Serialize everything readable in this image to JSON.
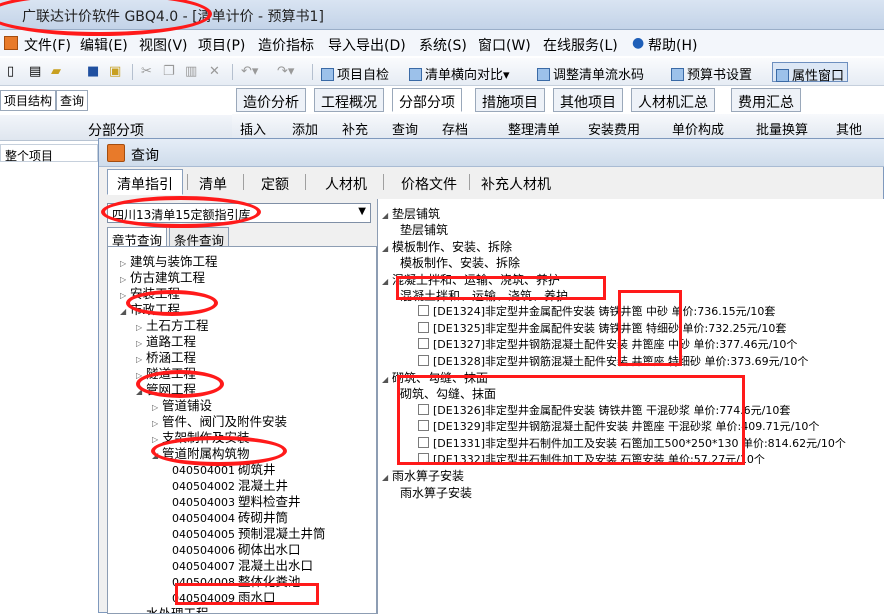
{
  "app": {
    "title": "广联达计价软件 GBQ4.0 - [清单计价 - 预算书1]"
  },
  "menu": [
    "文件(F)",
    "编辑(E)",
    "视图(V)",
    "项目(P)",
    "造价指标",
    "导入导出(D)",
    "系统(S)",
    "窗口(W)",
    "在线服务(L)",
    "帮助(H)"
  ],
  "toolbar": {
    "project_check": "项目自检",
    "compare": "清单横向对比",
    "adjust_flow": "调整清单流水码",
    "budget_settings": "预算书设置",
    "property_window": "属性窗口"
  },
  "left_panel": {
    "tabs": [
      "项目结构",
      "查询"
    ],
    "header": "分部分项",
    "root_item": "整个项目"
  },
  "main_tabs": [
    "造价分析",
    "工程概况",
    "分部分项",
    "措施项目",
    "其他项目",
    "人材机汇总",
    "费用汇总"
  ],
  "sub_toolbar": [
    "插入",
    "添加",
    "补充",
    "查询",
    "存档",
    "整理清单",
    "安装费用",
    "单价构成",
    "批量换算",
    "其他"
  ],
  "dialog": {
    "title": "查询",
    "tabs": [
      "清单指引",
      "清单",
      "定额",
      "人材机",
      "价格文件",
      "补充人材机"
    ],
    "library": "四川13清单15定额指引库",
    "search_tabs": [
      "章节查询",
      "条件查询"
    ],
    "tree": [
      {
        "label": "建筑与装饰工程",
        "level": 0,
        "expanded": false
      },
      {
        "label": "仿古建筑工程",
        "level": 0,
        "expanded": false
      },
      {
        "label": "安装工程",
        "level": 0,
        "expanded": false
      },
      {
        "label": "市政工程",
        "level": 0,
        "expanded": true
      },
      {
        "label": "土石方工程",
        "level": 1,
        "expanded": false
      },
      {
        "label": "道路工程",
        "level": 1,
        "expanded": false
      },
      {
        "label": "桥涵工程",
        "level": 1,
        "expanded": false
      },
      {
        "label": "隧道工程",
        "level": 1,
        "expanded": false
      },
      {
        "label": "管网工程",
        "level": 1,
        "expanded": true
      },
      {
        "label": "管道铺设",
        "level": 2,
        "expanded": false
      },
      {
        "label": "管件、阀门及附件安装",
        "level": 2,
        "expanded": false
      },
      {
        "label": "支架制作及安装",
        "level": 2,
        "expanded": false
      },
      {
        "label": "管道附属构筑物",
        "level": 2,
        "expanded": true
      },
      {
        "code": "040504001",
        "label": "砌筑井",
        "level": 3
      },
      {
        "code": "040504002",
        "label": "混凝土井",
        "level": 3
      },
      {
        "code": "040504003",
        "label": "塑料检查井",
        "level": 3
      },
      {
        "code": "040504004",
        "label": "砖砌井筒",
        "level": 3
      },
      {
        "code": "040504005",
        "label": "预制混凝土井筒",
        "level": 3
      },
      {
        "code": "040504006",
        "label": "砌体出水口",
        "level": 3
      },
      {
        "code": "040504007",
        "label": "混凝土出水口",
        "level": 3
      },
      {
        "code": "040504008",
        "label": "整体化粪池",
        "level": 3
      },
      {
        "code": "040504009",
        "label": "雨水口",
        "level": 3
      },
      {
        "label": "水处理工程",
        "level": 1,
        "expanded": false
      }
    ],
    "right_tree": [
      {
        "label": "垫层铺筑",
        "level": 0
      },
      {
        "label": "垫层铺筑",
        "level": 1
      },
      {
        "label": "模板制作、安装、拆除",
        "level": 0
      },
      {
        "label": "模板制作、安装、拆除",
        "level": 1
      },
      {
        "label": "混凝土拌和、运输、浇筑、养护",
        "level": 0
      },
      {
        "label": "混凝土拌和、运输、浇筑、养护",
        "level": 1
      },
      {
        "label": "[DE1324]非定型井金属配件安装 铸铁井篦 中砂 单价:736.15元/10套",
        "level": 2
      },
      {
        "label": "[DE1325]非定型井金属配件安装 铸铁井篦 特细砂 单价:732.25元/10套",
        "level": 2
      },
      {
        "label": "[DE1327]非定型井钢筋混凝土配件安装 井篦座 中砂 单价:377.46元/10个",
        "level": 2
      },
      {
        "label": "[DE1328]非定型井钢筋混凝土配件安装 井篦座 特细砂 单价:373.69元/10个",
        "level": 2
      },
      {
        "label": "砌筑、勾缝、抹面",
        "level": 0
      },
      {
        "label": "砌筑、勾缝、抹面",
        "level": 1
      },
      {
        "label": "[DE1326]非定型井金属配件安装 铸铁井篦 干混砂浆 单价:774.6元/10套",
        "level": 2
      },
      {
        "label": "[DE1329]非定型井钢筋混凝土配件安装 井篦座 干混砂浆 单价:409.71元/10个",
        "level": 2
      },
      {
        "label": "[DE1331]非定型井石制件加工及安装 石篦加工500*250*130 单价:814.62元/10个",
        "level": 2
      },
      {
        "label": "[DE1332]非定型井石制件加工及安装 石篦安装 单价:57.27元/10个",
        "level": 2
      },
      {
        "label": "雨水箅子安装",
        "level": 0
      },
      {
        "label": "雨水箅子安装",
        "level": 1
      }
    ]
  }
}
